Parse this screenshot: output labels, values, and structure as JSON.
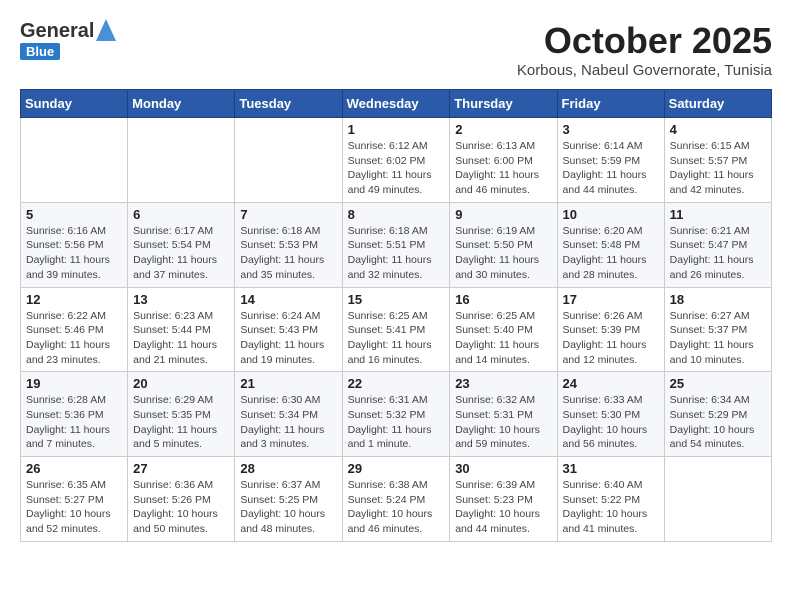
{
  "header": {
    "logo_line1": "General",
    "logo_line2": "Blue",
    "month": "October 2025",
    "location": "Korbous, Nabeul Governorate, Tunisia"
  },
  "days_of_week": [
    "Sunday",
    "Monday",
    "Tuesday",
    "Wednesday",
    "Thursday",
    "Friday",
    "Saturday"
  ],
  "weeks": [
    [
      {
        "day": "",
        "info": ""
      },
      {
        "day": "",
        "info": ""
      },
      {
        "day": "",
        "info": ""
      },
      {
        "day": "1",
        "info": "Sunrise: 6:12 AM\nSunset: 6:02 PM\nDaylight: 11 hours and 49 minutes."
      },
      {
        "day": "2",
        "info": "Sunrise: 6:13 AM\nSunset: 6:00 PM\nDaylight: 11 hours and 46 minutes."
      },
      {
        "day": "3",
        "info": "Sunrise: 6:14 AM\nSunset: 5:59 PM\nDaylight: 11 hours and 44 minutes."
      },
      {
        "day": "4",
        "info": "Sunrise: 6:15 AM\nSunset: 5:57 PM\nDaylight: 11 hours and 42 minutes."
      }
    ],
    [
      {
        "day": "5",
        "info": "Sunrise: 6:16 AM\nSunset: 5:56 PM\nDaylight: 11 hours and 39 minutes."
      },
      {
        "day": "6",
        "info": "Sunrise: 6:17 AM\nSunset: 5:54 PM\nDaylight: 11 hours and 37 minutes."
      },
      {
        "day": "7",
        "info": "Sunrise: 6:18 AM\nSunset: 5:53 PM\nDaylight: 11 hours and 35 minutes."
      },
      {
        "day": "8",
        "info": "Sunrise: 6:18 AM\nSunset: 5:51 PM\nDaylight: 11 hours and 32 minutes."
      },
      {
        "day": "9",
        "info": "Sunrise: 6:19 AM\nSunset: 5:50 PM\nDaylight: 11 hours and 30 minutes."
      },
      {
        "day": "10",
        "info": "Sunrise: 6:20 AM\nSunset: 5:48 PM\nDaylight: 11 hours and 28 minutes."
      },
      {
        "day": "11",
        "info": "Sunrise: 6:21 AM\nSunset: 5:47 PM\nDaylight: 11 hours and 26 minutes."
      }
    ],
    [
      {
        "day": "12",
        "info": "Sunrise: 6:22 AM\nSunset: 5:46 PM\nDaylight: 11 hours and 23 minutes."
      },
      {
        "day": "13",
        "info": "Sunrise: 6:23 AM\nSunset: 5:44 PM\nDaylight: 11 hours and 21 minutes."
      },
      {
        "day": "14",
        "info": "Sunrise: 6:24 AM\nSunset: 5:43 PM\nDaylight: 11 hours and 19 minutes."
      },
      {
        "day": "15",
        "info": "Sunrise: 6:25 AM\nSunset: 5:41 PM\nDaylight: 11 hours and 16 minutes."
      },
      {
        "day": "16",
        "info": "Sunrise: 6:25 AM\nSunset: 5:40 PM\nDaylight: 11 hours and 14 minutes."
      },
      {
        "day": "17",
        "info": "Sunrise: 6:26 AM\nSunset: 5:39 PM\nDaylight: 11 hours and 12 minutes."
      },
      {
        "day": "18",
        "info": "Sunrise: 6:27 AM\nSunset: 5:37 PM\nDaylight: 11 hours and 10 minutes."
      }
    ],
    [
      {
        "day": "19",
        "info": "Sunrise: 6:28 AM\nSunset: 5:36 PM\nDaylight: 11 hours and 7 minutes."
      },
      {
        "day": "20",
        "info": "Sunrise: 6:29 AM\nSunset: 5:35 PM\nDaylight: 11 hours and 5 minutes."
      },
      {
        "day": "21",
        "info": "Sunrise: 6:30 AM\nSunset: 5:34 PM\nDaylight: 11 hours and 3 minutes."
      },
      {
        "day": "22",
        "info": "Sunrise: 6:31 AM\nSunset: 5:32 PM\nDaylight: 11 hours and 1 minute."
      },
      {
        "day": "23",
        "info": "Sunrise: 6:32 AM\nSunset: 5:31 PM\nDaylight: 10 hours and 59 minutes."
      },
      {
        "day": "24",
        "info": "Sunrise: 6:33 AM\nSunset: 5:30 PM\nDaylight: 10 hours and 56 minutes."
      },
      {
        "day": "25",
        "info": "Sunrise: 6:34 AM\nSunset: 5:29 PM\nDaylight: 10 hours and 54 minutes."
      }
    ],
    [
      {
        "day": "26",
        "info": "Sunrise: 6:35 AM\nSunset: 5:27 PM\nDaylight: 10 hours and 52 minutes."
      },
      {
        "day": "27",
        "info": "Sunrise: 6:36 AM\nSunset: 5:26 PM\nDaylight: 10 hours and 50 minutes."
      },
      {
        "day": "28",
        "info": "Sunrise: 6:37 AM\nSunset: 5:25 PM\nDaylight: 10 hours and 48 minutes."
      },
      {
        "day": "29",
        "info": "Sunrise: 6:38 AM\nSunset: 5:24 PM\nDaylight: 10 hours and 46 minutes."
      },
      {
        "day": "30",
        "info": "Sunrise: 6:39 AM\nSunset: 5:23 PM\nDaylight: 10 hours and 44 minutes."
      },
      {
        "day": "31",
        "info": "Sunrise: 6:40 AM\nSunset: 5:22 PM\nDaylight: 10 hours and 41 minutes."
      },
      {
        "day": "",
        "info": ""
      }
    ]
  ]
}
